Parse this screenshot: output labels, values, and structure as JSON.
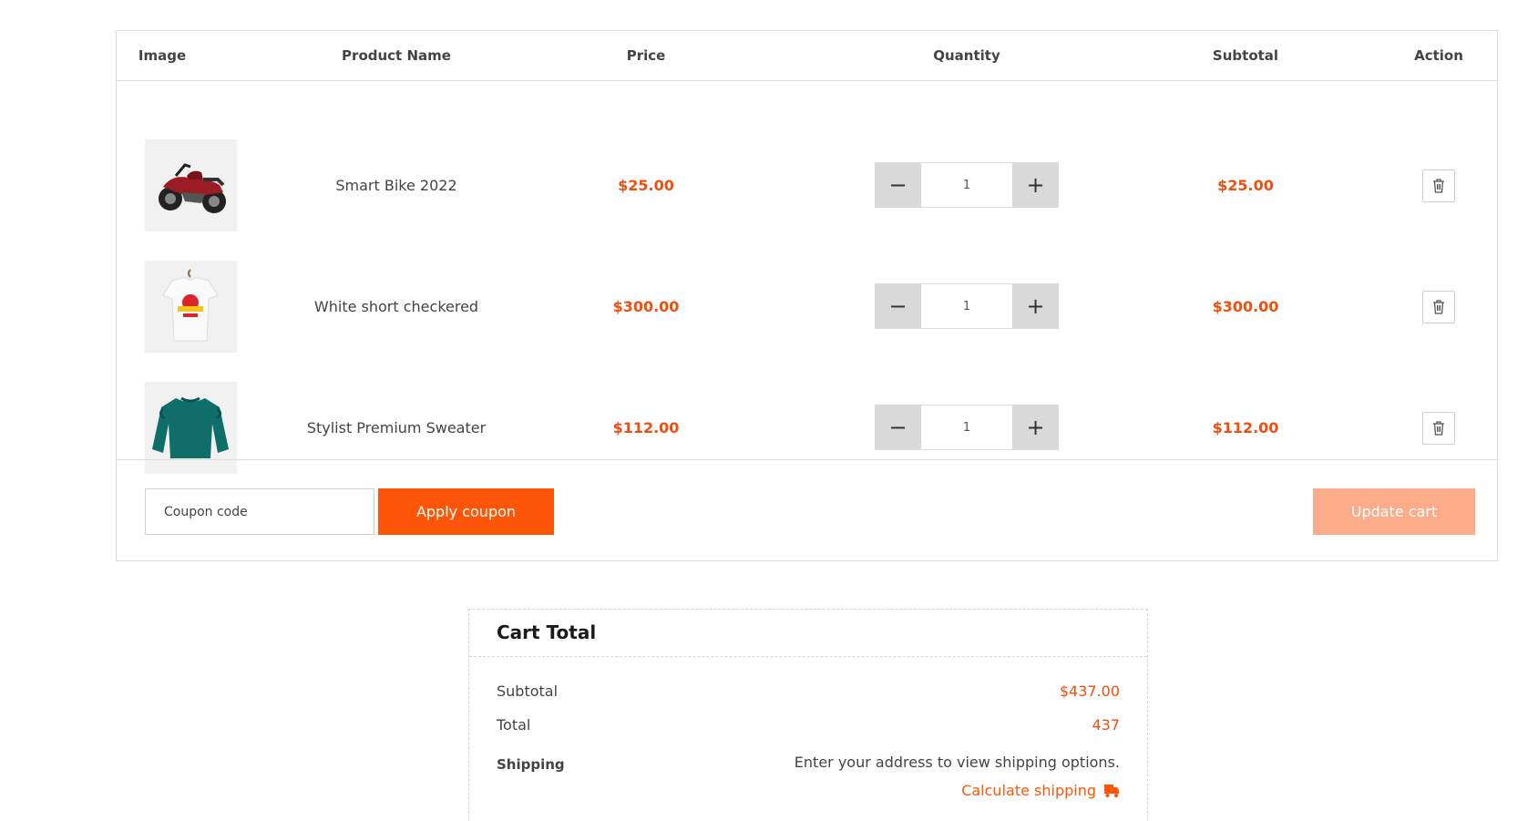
{
  "table": {
    "headers": {
      "image": "Image",
      "product_name": "Product Name",
      "price": "Price",
      "quantity": "Quantity",
      "subtotal": "Subtotal",
      "action": "Action"
    },
    "rows": [
      {
        "image": "motorcycle-image",
        "name": "Smart Bike 2022",
        "price": "$25.00",
        "quantity": "1",
        "subtotal": "$25.00"
      },
      {
        "image": "tshirt-image",
        "name": "White short checkered",
        "price": "$300.00",
        "quantity": "1",
        "subtotal": "$300.00"
      },
      {
        "image": "sweater-image",
        "name": "Stylist Premium Sweater",
        "price": "$112.00",
        "quantity": "1",
        "subtotal": "$112.00"
      }
    ],
    "icons": {
      "minus": "−",
      "plus": "+",
      "delete": "trash-icon"
    }
  },
  "coupon": {
    "placeholder": "Coupon code",
    "apply_label": "Apply coupon",
    "update_label": "Update cart"
  },
  "totals": {
    "title": "Cart Total",
    "subtotal_label": "Subtotal",
    "subtotal_value": "$437.00",
    "total_label": "Total",
    "total_value": "437",
    "shipping_label": "Shipping",
    "shipping_text": "Enter your address to view shipping options.",
    "calc_label": "Calculate shipping",
    "calc_icon": "truck-icon"
  },
  "colors": {
    "accent": "#fe5608",
    "price": "#f04f0d",
    "update_button": "#fdac8a",
    "qty_button": "#dadada"
  }
}
